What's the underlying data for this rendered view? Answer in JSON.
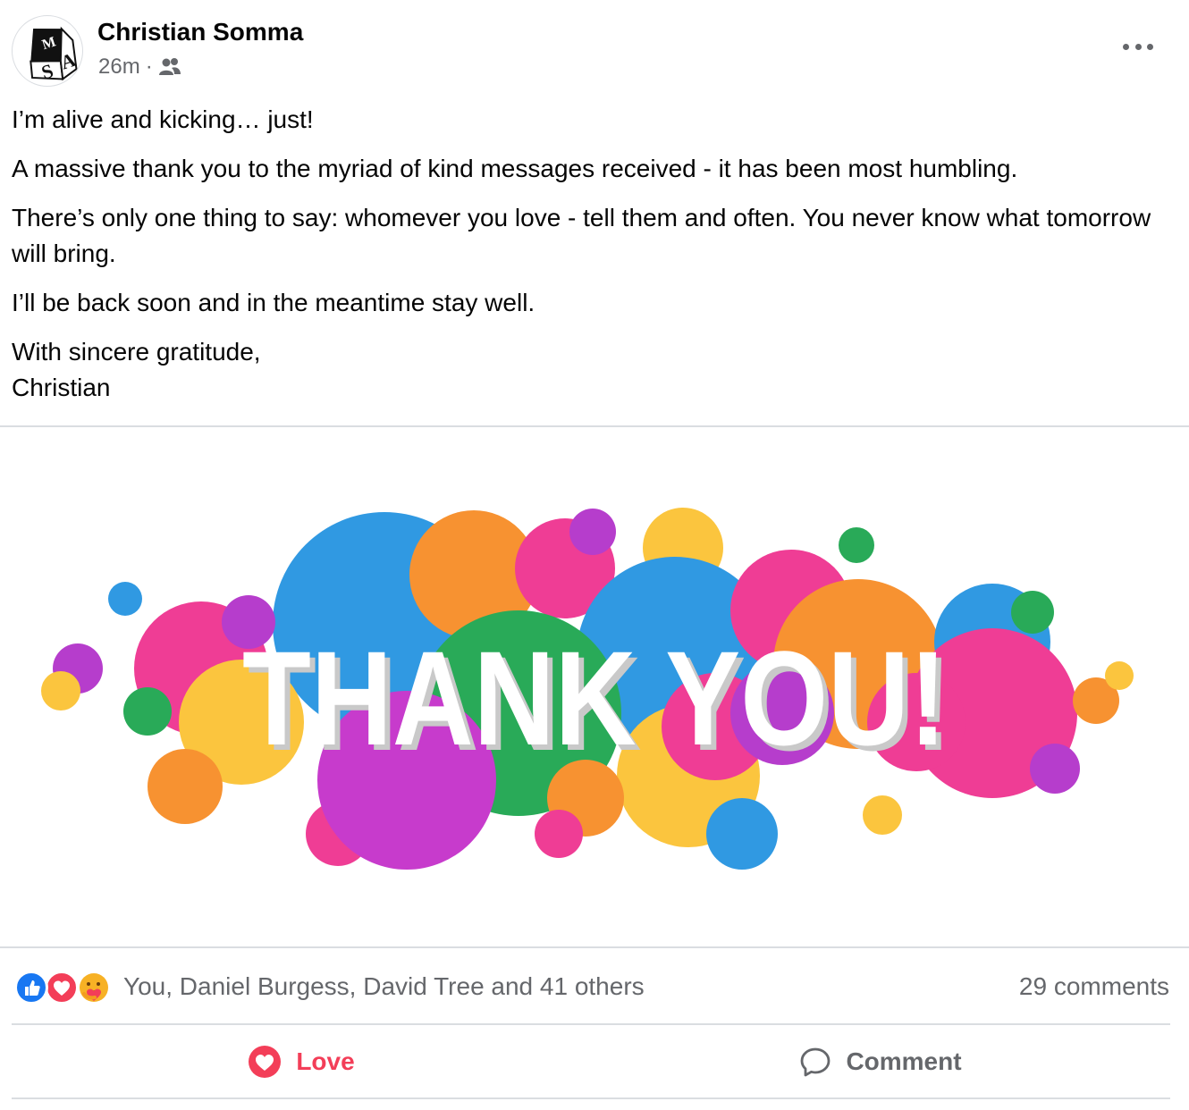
{
  "post": {
    "author": "Christian Somma",
    "time": "26m",
    "separator": "·",
    "audience_icon": "friends-icon",
    "more_icon": "more-horizontal-icon",
    "avatar_letters": "SA",
    "paragraphs": [
      "I’m alive and kicking… just!",
      "A massive thank you to the myriad of kind messages received - it has been most humbling.",
      "There’s only one thing to say: whomever you love - tell them and often. You never know what tomorrow will bring.",
      "I’ll be back soon and in the meantime stay well.",
      "With sincere gratitude,\nChristian"
    ],
    "image_text": "THANK YOU!"
  },
  "reactions": {
    "icons": [
      "like-icon",
      "love-icon",
      "care-icon"
    ],
    "text": "You, Daniel Burgess, David Tree and 41 others",
    "comments": "29 comments"
  },
  "actions": {
    "love_label": "Love",
    "comment_label": "Comment"
  },
  "colors": {
    "love": "#f33e58",
    "like": "#1877f2",
    "secondary_text": "#65676b",
    "divider": "#dadde1"
  }
}
